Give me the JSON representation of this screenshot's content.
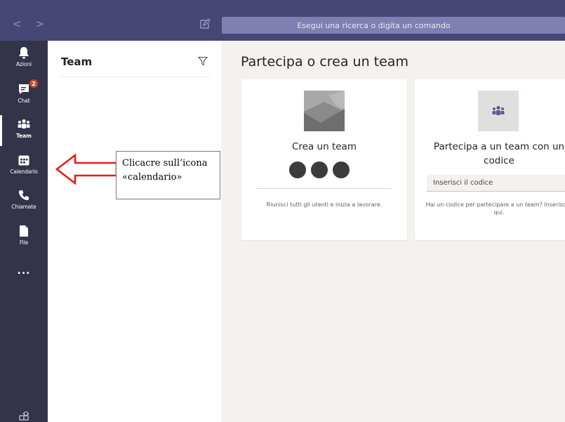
{
  "topbar": {
    "back_glyph": "<",
    "forward_glyph": ">",
    "compose_icon": "compose-icon",
    "search_placeholder": "Esegui una ricerca o digita un comando"
  },
  "rail": {
    "items": [
      {
        "label": "Azioni",
        "icon": "bell-icon"
      },
      {
        "label": "Chat",
        "icon": "chat-icon",
        "badge": "2"
      },
      {
        "label": "Team",
        "icon": "teams-icon",
        "active": true
      },
      {
        "label": "Calendario",
        "icon": "calendar-icon"
      },
      {
        "label": "Chiamate",
        "icon": "phone-icon"
      },
      {
        "label": "File",
        "icon": "file-icon"
      }
    ],
    "more": "...",
    "bottom_icon": "apps-icon"
  },
  "panel": {
    "title": "Team",
    "filter_icon": "filter-icon"
  },
  "main": {
    "title": "Partecipa o crea un team",
    "create_card": {
      "heading": "Crea un team",
      "description": "Riunisci tutti gli utenti e inizia a lavorare."
    },
    "join_card": {
      "heading": "Partecipa a un team con un codice",
      "code_placeholder": "Inserisci il codice",
      "description": "Hai un codice per partecipare a un team? Inseriscilo qui."
    }
  },
  "annotation": {
    "text": "Clicacre sull’icona «calendario»"
  },
  "colors": {
    "topbar": "#464775",
    "rail": "#33344a",
    "search": "#7f80b1",
    "badge": "#cc4a31",
    "annotation_arrow": "#e0201a"
  }
}
